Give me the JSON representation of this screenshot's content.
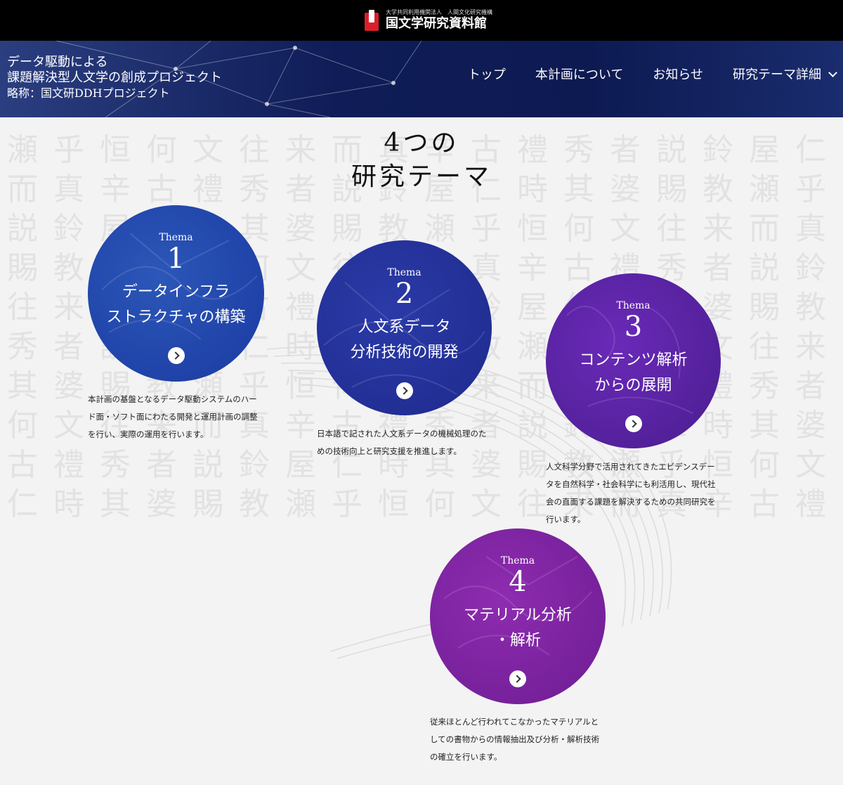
{
  "header": {
    "org_small": "大学共同利用機関法人　人間文化研究機構",
    "org_name": "国文学研究資料館",
    "project_line1": "データ駆動による",
    "project_line2": "課題解決型人文学の創成プロジェクト",
    "project_line3": "略称：国文研DDHプロジェクト"
  },
  "nav": {
    "items": [
      "トップ",
      "本計画について",
      "お知らせ",
      "研究テーマ詳細"
    ]
  },
  "section": {
    "title_line1": "4つの",
    "title_line2": "研究テーマ"
  },
  "themes": [
    {
      "label": "Thema",
      "number": "1",
      "title_line1": "データインフラ",
      "title_line2": "ストラクチャの構築",
      "description": "本計画の基盤となるデータ駆動システムのハード面・ソフト面にわたる開発と運用計画の調整を行い、実際の運用を行います。",
      "color": "#1e45aa"
    },
    {
      "label": "Thema",
      "number": "2",
      "title_line1": "人文系データ",
      "title_line2": "分析技術の開発",
      "description": "日本語で記された人文系データの機械処理のための技術向上と研究支援を推進します。",
      "color": "#232f96"
    },
    {
      "label": "Thema",
      "number": "3",
      "title_line1": "コンテンツ解析",
      "title_line2": "からの展開",
      "description": "人文科学分野で活用されてきたエビデンスデータを自然科学・社会科学にも利活用し、現代社会の直面する課題を解決するための共同研究を行います。",
      "color": "#5a22a2"
    },
    {
      "label": "Thema",
      "number": "4",
      "title_line1": "マテリアル分析",
      "title_line2": "・解析",
      "description": "従来ほとんど行われてこなかったマテリアルとしての書物からの情報抽出及び分析・解析技術の確立を行います。",
      "color": "#7f24a2"
    }
  ],
  "colors": {
    "topbar": "#000000",
    "header_bg": "#0f1c57",
    "page_bg": "#f3f3f3"
  }
}
